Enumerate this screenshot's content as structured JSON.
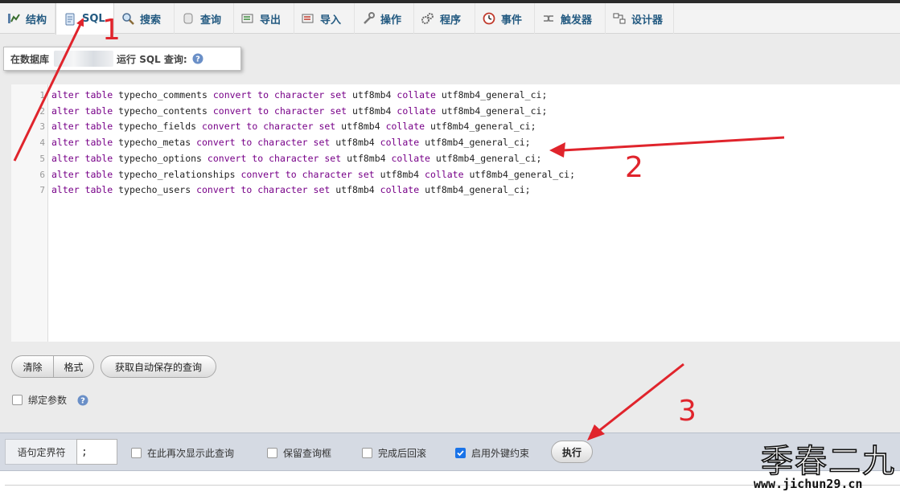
{
  "tabs": [
    {
      "label": "结构",
      "icon": "structure-icon"
    },
    {
      "label": "SQL",
      "icon": "sql-icon",
      "active": true
    },
    {
      "label": "搜索",
      "icon": "search-icon"
    },
    {
      "label": "查询",
      "icon": "query-icon"
    },
    {
      "label": "导出",
      "icon": "export-icon"
    },
    {
      "label": "导入",
      "icon": "import-icon"
    },
    {
      "label": "操作",
      "icon": "operations-icon"
    },
    {
      "label": "程序",
      "icon": "routines-icon"
    },
    {
      "label": "事件",
      "icon": "events-icon"
    },
    {
      "label": "触发器",
      "icon": "triggers-icon"
    },
    {
      "label": "设计器",
      "icon": "designer-icon"
    }
  ],
  "legend": {
    "prefix": "在数据库",
    "suffix": "运行 SQL 查询:",
    "help_icon": "help-icon"
  },
  "editor": {
    "line_numbers": [
      "1",
      "2",
      "3",
      "4",
      "5",
      "6",
      "7"
    ],
    "lines": [
      "alter table typecho_comments convert to character set utf8mb4 collate utf8mb4_general_ci;",
      "alter table typecho_contents convert to character set utf8mb4 collate utf8mb4_general_ci;",
      "alter table typecho_fields convert to character set utf8mb4 collate utf8mb4_general_ci;",
      "alter table typecho_metas convert to character set utf8mb4 collate utf8mb4_general_ci;",
      "alter table typecho_options convert to character set utf8mb4 collate utf8mb4_general_ci;",
      "alter table typecho_relationships convert to character set utf8mb4 collate utf8mb4_general_ci;",
      "alter table typecho_users convert to character set utf8mb4 collate utf8mb4_general_ci;"
    ]
  },
  "buttons": {
    "clear": "清除",
    "format": "格式",
    "get_autosaved": "获取自动保存的查询",
    "execute": "执行"
  },
  "bind_params": {
    "label": "绑定参数",
    "checked": false
  },
  "bottom": {
    "delimiter_label": "语句定界符",
    "delimiter_value": ";",
    "show_again": {
      "label": "在此再次显示此查询",
      "checked": false
    },
    "retain_box": {
      "label": "保留查询框",
      "checked": false
    },
    "rollback": {
      "label": "完成后回滚",
      "checked": false
    },
    "foreign_keys": {
      "label": "启用外键约束",
      "checked": true
    }
  },
  "annotations": [
    "1",
    "2",
    "3"
  ],
  "watermark": {
    "title": "季春二九",
    "url": "www.jichun29.cn"
  },
  "colors": {
    "link": "#235a81",
    "keyword": "#770088",
    "arrow": "#e0242c",
    "checkbox_on": "#1a73e8"
  }
}
